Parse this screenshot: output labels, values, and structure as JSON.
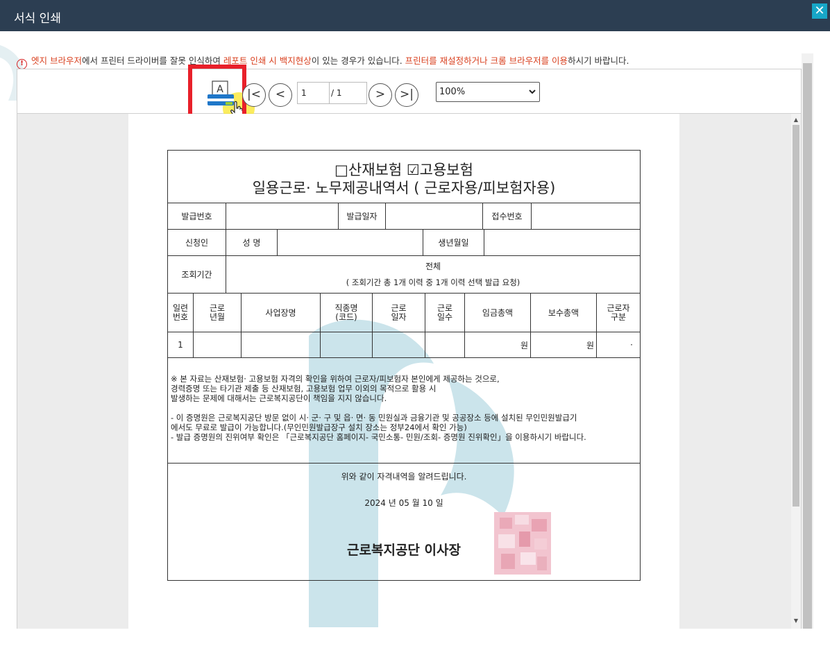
{
  "window": {
    "title": "서식 인쇄",
    "close_icon": "close-icon",
    "accent": "#17a7c8"
  },
  "notice": {
    "part1": "엣지 브라우저",
    "part2": "에서 프린터 드라이버를 잘못 인식하여 ",
    "part3": "레포트 인쇄 시 백지현상",
    "part4": "이 있는 경우가 있습니다. ",
    "part5": "프린터를 재설정하거나 크롬 브라우저를 이용",
    "part6": "하시기 바랍니다."
  },
  "toolbar": {
    "print_letter": "A",
    "first_page": "|<",
    "prev_page": "<",
    "next_page": ">",
    "last_page": ">|",
    "current_page": "1",
    "total_pages": "/ 1",
    "zoom": "100%"
  },
  "document": {
    "title_line1": "□산재보험 ☑고용보험",
    "title_line2": "일용근로· 노무제공내역서 ( 근로자용/피보험자용)",
    "issue_no_label": "발급번호",
    "issue_date_label": "발급일자",
    "receipt_no_label": "접수번호",
    "applicant_label": "신청인",
    "name_label": "성 명",
    "birth_label": "생년월일",
    "period_label": "조회기간",
    "period_value": "전체",
    "period_note": "( 조회기간 총  1개 이력 중 1개 이력 선택 발급 요청)",
    "columns": [
      "일련\n번호",
      "근로\n년월",
      "사업장명",
      "직종명\n(코드)",
      "근로\n일자",
      "근로\n일수",
      "임금총액",
      "보수총액",
      "근로자\n구분"
    ],
    "row": {
      "seq": "1",
      "wage_unit": "원",
      "pay_unit": "원",
      "type": "·"
    },
    "notes": [
      "※ 본 자료는 산재보험· 고용보험 자격의 확인을 위하여 근로자/피보험자 본인에게 제공하는 것으로,",
      "    경력증명 또는 타기관 제출 등 산재보험, 고용보험 업무 이외의 목적으로 활용 시",
      "    발생하는 문제에 대해서는 근로복지공단이 책임을 지지 않습니다.",
      "",
      "-  이 증명원은 근로복지공단 방문 없이 시· 군· 구 및 읍· 면· 동 민원실과 금융기관 및 공공장소 등에 설치된 무인민원발급기",
      "    에서도 무료로 발급이 가능합니다.(무인민원발급장구 설치 장소는 정부24에서 확인 가능)",
      "-  발급 증명원의 진위여부 확인은 「근로복지공단 홈페이지- 국민소통- 민원/조회- 증명원 진위확인」을 이용하시기 바랍니다."
    ],
    "closing_text": "위와 같이 자격내역을 알려드립니다.",
    "date": "2024 년 05 월 10 일",
    "signer": "근로복지공단  이사장"
  }
}
